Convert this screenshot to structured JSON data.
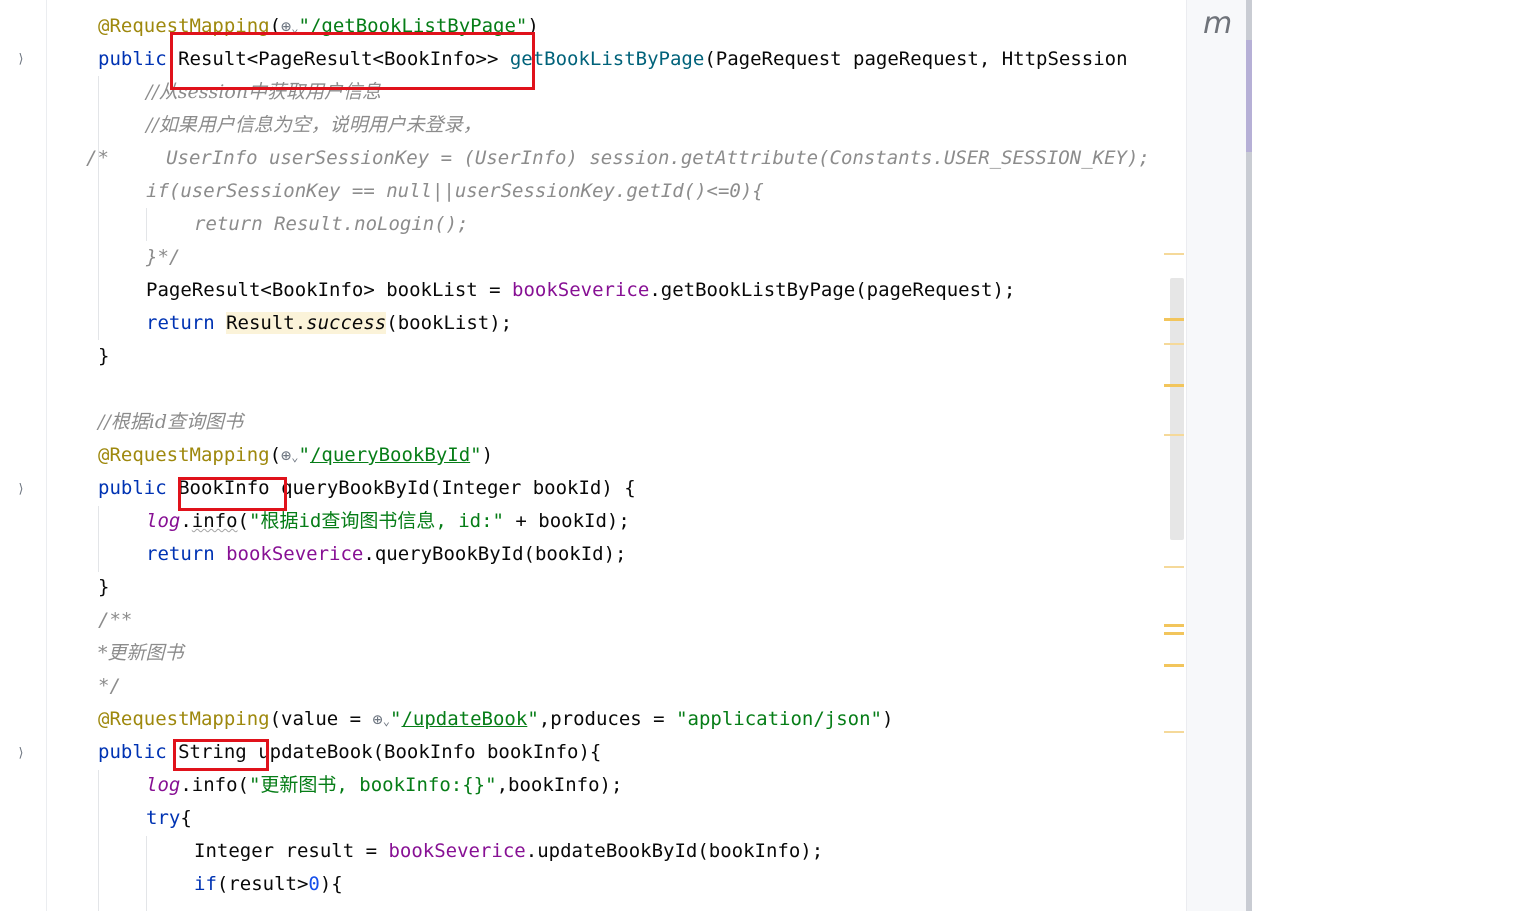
{
  "sidebar": {
    "icon": "m-icon",
    "letter": "m"
  },
  "code": {
    "l1_ann": "@RequestMapping",
    "l1_url": "/getBookListByPage",
    "l2_public": "public",
    "l2_type": "Result<PageResult<BookInfo>>",
    "l2_method": "getBookListByPage",
    "l2_params": "(PageRequest pageRequest, HttpSession",
    "l3_comment": "//从session中获取用户信息",
    "l4_comment": "//如果用户信息为空，说明用户未登录，",
    "l5_comment": "/*     UserInfo userSessionKey = (UserInfo) session.getAttribute(Constants.USER_SESSION_KEY);",
    "l6_comment": "if(userSessionKey == null||userSessionKey.getId()<=0){",
    "l7_comment": "return Result.noLogin();",
    "l8_comment": "}*/",
    "l9_a": "PageResult<BookInfo> bookList = ",
    "l9_field": "bookSeverice",
    "l9_b": ".getBookListByPage(pageRequest);",
    "l10_return": "return",
    "l10_cls": "Result.",
    "l10_method": "success",
    "l10_b": "(bookList);",
    "l11_brace": "}",
    "l12_comment": "//根据id查询图书",
    "l13_ann": "@RequestMapping",
    "l13_url": "/queryBookById",
    "l14_public": "public",
    "l14_type": "BookInfo",
    "l14_rest": "queryBookById(Integer bookId) {",
    "l15_log": "log",
    "l15_info": "info",
    "l15_str": "\"根据id查询图书信息, id:\"",
    "l15_rest": " + bookId);",
    "l16_return": "return",
    "l16_field": "bookSeverice",
    "l16_rest": ".queryBookById(bookId);",
    "l17_brace": "}",
    "l18_comment": "/**",
    "l19_comment": "*更新图书",
    "l20_comment": "*/",
    "l21_ann": "@RequestMapping",
    "l21_value": "(value = ",
    "l21_url": "/updateBook",
    "l21_produces": ",produces = ",
    "l21_str": "\"application/json\"",
    "l22_public": "public",
    "l22_type": "String",
    "l22_rest": "updateBook(BookInfo bookInfo){",
    "l23_log": "log",
    "l23_info": ".info(",
    "l23_str": "\"更新图书, bookInfo:{}\"",
    "l23_rest": ",bookInfo);",
    "l24_try": "try",
    "l24_brace": "{",
    "l25_a": "Integer result = ",
    "l25_field": "bookSeverice",
    "l25_rest": ".updateBookById(bookInfo);",
    "l26_if": "if",
    "l26_a": "(result>",
    "l26_num": "0",
    "l26_b": "){"
  },
  "colors": {
    "keyword": "#0033b3",
    "annotation": "#9e880d",
    "string": "#067d17",
    "field": "#871094",
    "comment": "#8c8c8c",
    "highlight_box": "#e0121b"
  }
}
